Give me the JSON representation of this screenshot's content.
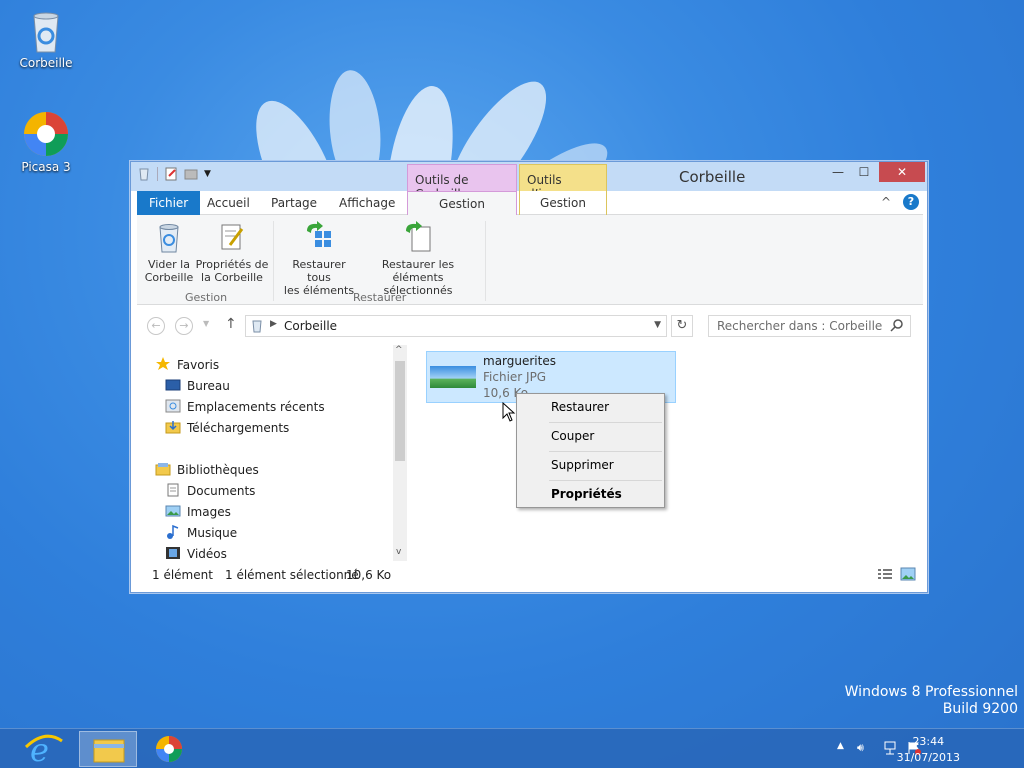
{
  "desktop": {
    "icons": [
      {
        "label": "Corbeille",
        "icon": "recycle-bin-icon"
      },
      {
        "label": "Picasa 3",
        "icon": "picasa-icon"
      }
    ],
    "watermark": {
      "line1": "Windows 8 Professionnel",
      "line2": "Build 9200"
    }
  },
  "window": {
    "title": "Corbeille",
    "context_tabs": [
      {
        "group": "Outils de Corbeille",
        "tab": "Gestion",
        "color": "#e3a9e6"
      },
      {
        "group": "Outils d’image",
        "tab": "Gestion",
        "color": "#f7e28a"
      }
    ],
    "ribbon_tabs": [
      "Fichier",
      "Accueil",
      "Partage",
      "Affichage"
    ],
    "ribbon": {
      "groups": [
        {
          "label": "Gestion",
          "buttons": [
            {
              "line1": "Vider la",
              "line2": "Corbeille",
              "icon": "empty-bin-icon"
            },
            {
              "line1": "Propriétés de",
              "line2": "la Corbeille",
              "icon": "properties-icon"
            }
          ]
        },
        {
          "label": "Restaurer",
          "buttons": [
            {
              "line1": "Restaurer tous",
              "line2": "les éléments",
              "icon": "restore-all-icon"
            },
            {
              "line1": "Restaurer les éléments",
              "line2": "sélectionnés",
              "icon": "restore-selected-icon"
            }
          ]
        }
      ]
    },
    "address": {
      "path": "Corbeille"
    },
    "search": {
      "placeholder": "Rechercher dans : Corbeille"
    },
    "nav": {
      "favorites": {
        "label": "Favoris",
        "items": [
          "Bureau",
          "Emplacements récents",
          "Téléchargements"
        ]
      },
      "libraries": {
        "label": "Bibliothèques",
        "items": [
          "Documents",
          "Images",
          "Musique",
          "Vidéos"
        ]
      }
    },
    "file": {
      "name": "marguerites",
      "type": "Fichier JPG",
      "size": "10,6 Ko"
    },
    "status": {
      "count": "1 élément",
      "selected": "1 élément sélectionné",
      "size": "10,6 Ko"
    }
  },
  "context_menu": {
    "items": [
      "Restaurer",
      "Couper",
      "Supprimer",
      "Propriétés"
    ],
    "default_item": "Propriétés"
  },
  "taskbar": {
    "apps": [
      "internet-explorer-icon",
      "file-explorer-icon",
      "picasa-icon"
    ],
    "time": "23:44",
    "date": "31/07/2013"
  }
}
